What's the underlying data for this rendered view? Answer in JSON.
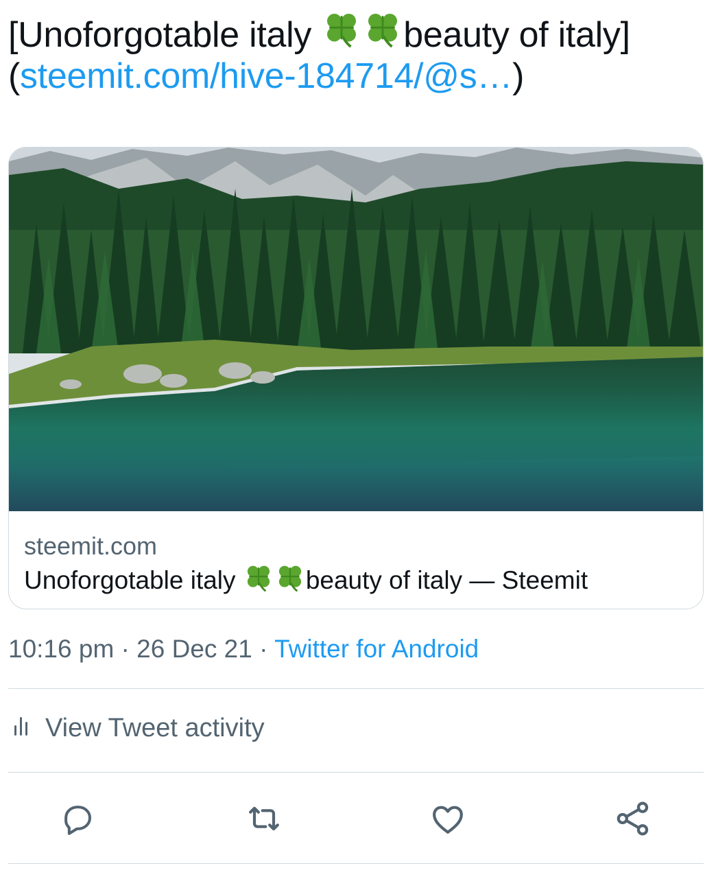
{
  "tweet": {
    "text_part1": "[Unoforgotable italy ",
    "text_part2": "beauty of italy](",
    "link_text": "steemit.com/hive-184714/@s…",
    "text_part3": ")",
    "emoji": "four-leaf-clover-icon"
  },
  "card": {
    "image": "alpine-lake-forest-mountain-photo",
    "domain": "steemit.com",
    "title_part1": "Unoforgotable italy ",
    "title_part2": "beauty of italy — Steemit"
  },
  "meta": {
    "time": "10:16 pm",
    "separator": " · ",
    "date": "26 Dec 21",
    "source": "Twitter for Android"
  },
  "activity": {
    "label": "View Tweet activity",
    "icon": "bar-chart-icon"
  },
  "actions": [
    {
      "name": "reply",
      "icon": "reply-icon"
    },
    {
      "name": "retweet",
      "icon": "retweet-icon"
    },
    {
      "name": "like",
      "icon": "heart-icon"
    },
    {
      "name": "share",
      "icon": "share-icon"
    }
  ],
  "colors": {
    "link": "#1d9bf0",
    "text": "#0f1419",
    "secondary": "#536471",
    "border": "#cfd9de",
    "clover": "#5aa62e"
  }
}
